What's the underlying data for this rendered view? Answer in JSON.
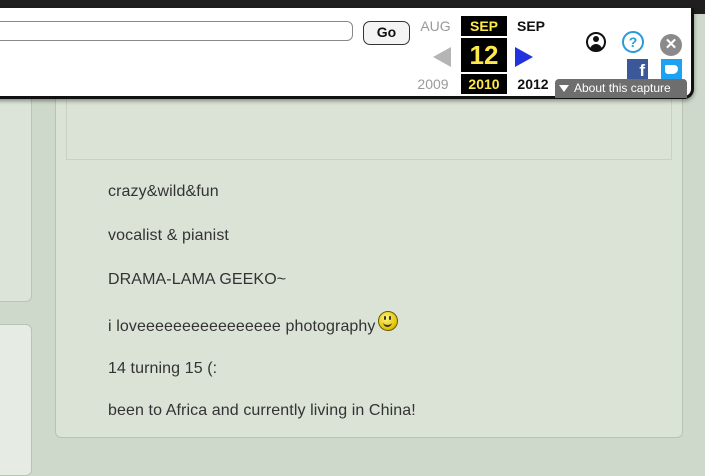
{
  "toolbar": {
    "url_value": "",
    "go_label": "Go",
    "prev_month": "AUG",
    "current_month": "SEP",
    "next_month": "SEP",
    "current_day": "12",
    "prev_year": "2009",
    "current_year": "2010",
    "next_year": "2012",
    "about_label": "About this capture",
    "help_glyph": "?",
    "close_glyph": "✕",
    "facebook_glyph": "f",
    "icons": [
      "user-icon",
      "help-icon",
      "close-icon",
      "facebook-icon",
      "twitter-icon",
      "prev-capture-arrow",
      "next-capture-arrow"
    ],
    "colors": {
      "highlight": "#ffe94a",
      "next_arrow": "#2233dd",
      "facebook": "#3b5998",
      "twitter": "#1da1f2"
    }
  },
  "profile": {
    "bio_lines": [
      "crazy&wild&fun",
      "vocalist & pianist",
      "DRAMA-LAMA GEEKO~",
      "i loveeeeeeeeeeeeeeee photography",
      "14 turning 15 (:",
      "been to Africa and currently living in China!"
    ],
    "emoticon": "smiley-icon"
  }
}
